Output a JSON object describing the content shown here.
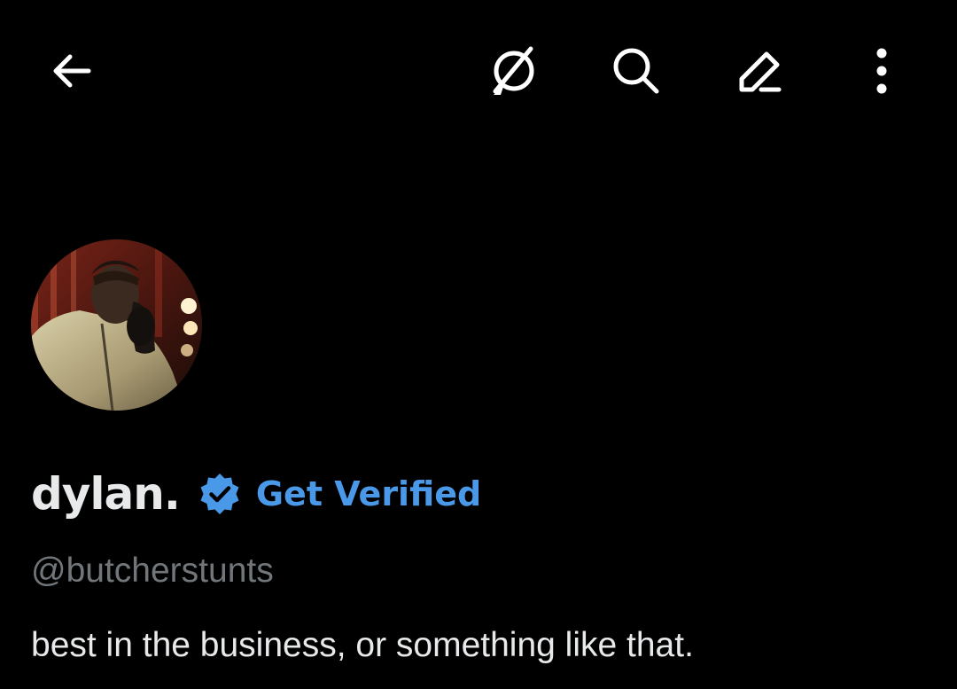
{
  "header": {
    "icons": [
      "back-arrow-icon",
      "grok-icon",
      "search-icon",
      "compose-icon",
      "more-icon"
    ]
  },
  "profile": {
    "display_name": "dylan.",
    "verified_badge_color": "#4a99e9",
    "get_verified_label": "Get Verified",
    "handle": "@butcherstunts",
    "bio": "best in the business, or something like that."
  },
  "colors": {
    "background": "#000000",
    "text_primary": "#e7e9ea",
    "text_secondary": "#71767b",
    "accent": "#4a99e9"
  }
}
